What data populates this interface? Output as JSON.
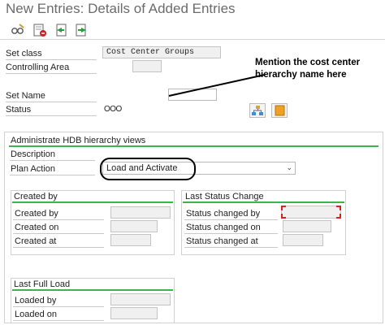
{
  "window": {
    "title": "New Entries: Details of Added Entries"
  },
  "toolbar": {
    "icons": [
      "glasses-edit-icon",
      "delete-icon",
      "previous-entry-icon",
      "next-entry-icon"
    ]
  },
  "header_fields": {
    "set_class": {
      "label": "Set class",
      "value": "Cost Center Groups"
    },
    "controlling_area": {
      "label": "Controlling Area",
      "value": ""
    },
    "set_name": {
      "label": "Set Name",
      "value": ""
    },
    "status": {
      "label": "Status",
      "value": "OOO"
    }
  },
  "annotation": {
    "text": "Mention the cost center hierarchy name here"
  },
  "hdb_section": {
    "title": "Administrate HDB hierarchy views",
    "description": {
      "label": "Description",
      "value": ""
    },
    "plan_action": {
      "label": "Plan Action",
      "selected": "Load and Activate"
    }
  },
  "created_by_group": {
    "title": "Created by",
    "rows": [
      {
        "label": "Created by",
        "value": ""
      },
      {
        "label": "Created on",
        "value": ""
      },
      {
        "label": "Created at",
        "value": ""
      }
    ]
  },
  "last_status_group": {
    "title": "Last Status Change",
    "rows": [
      {
        "label": "Status changed by",
        "value": ""
      },
      {
        "label": "Status changed on",
        "value": ""
      },
      {
        "label": "Status changed at",
        "value": ""
      }
    ]
  },
  "last_full_load_group": {
    "title": "Last Full Load",
    "rows": [
      {
        "label": "Loaded by",
        "value": ""
      },
      {
        "label": "Loaded on",
        "value": ""
      }
    ]
  },
  "colors": {
    "group_rule": "#3ab54a",
    "focus_corner": "#e02020",
    "delete_icon": "#d02020",
    "nav_icon": "#2e9a3e"
  }
}
